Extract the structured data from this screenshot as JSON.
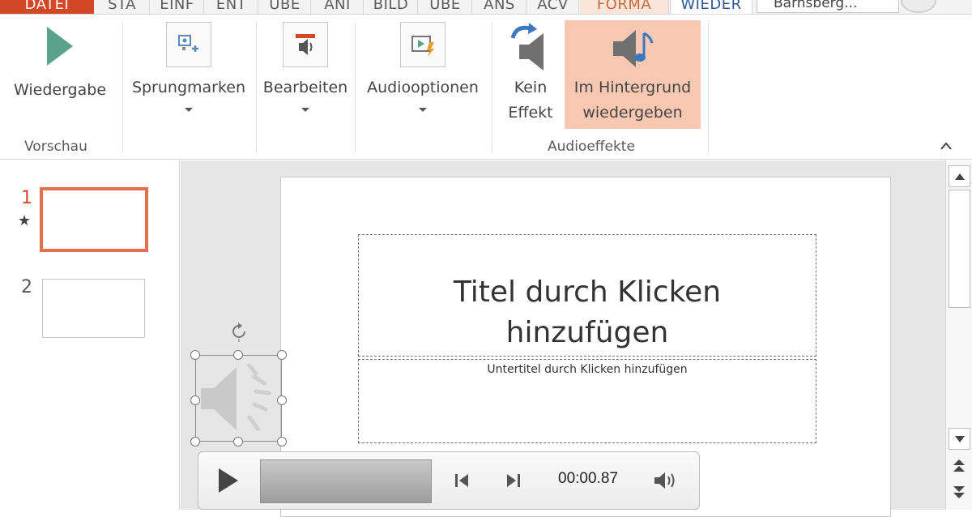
{
  "tabs": [
    {
      "label": "DATEI"
    },
    {
      "label": "STA"
    },
    {
      "label": "EINF"
    },
    {
      "label": "ENT"
    },
    {
      "label": "ÜBE"
    },
    {
      "label": "ANI"
    },
    {
      "label": "BILD"
    },
    {
      "label": "ÜBE"
    },
    {
      "label": "ANS"
    },
    {
      "label": "ACV"
    },
    {
      "label": "FORMA"
    },
    {
      "label": "WIEDER"
    }
  ],
  "account": {
    "name": "Barnsberg..."
  },
  "ribbon": {
    "play": {
      "label": "Wiedergabe"
    },
    "bookmarks": {
      "label": "Sprungmarken"
    },
    "edit": {
      "label": "Bearbeiten"
    },
    "audio_options": {
      "label": "Audiooptionen"
    },
    "no_effect": {
      "line1": "Kein",
      "line2": "Effekt"
    },
    "background": {
      "line1": "Im Hintergrund",
      "line2": "wiedergeben"
    },
    "groups": {
      "preview": "Vorschau",
      "audio_effects": "Audioeffekte"
    }
  },
  "thumbnails": [
    {
      "number": "1",
      "star": "★"
    },
    {
      "number": "2"
    }
  ],
  "slide": {
    "title_line1": "Titel durch  Klicken",
    "title_line2": "hinzufügen",
    "subtitle": "Untertitel durch  Klicken hinzufügen"
  },
  "player": {
    "time": "00:00.87"
  },
  "colors": {
    "accent": "#d24726",
    "selected_thumb": "#e1714f",
    "highlight": "#f9c8b2",
    "play_icon": "#5aa28c"
  }
}
